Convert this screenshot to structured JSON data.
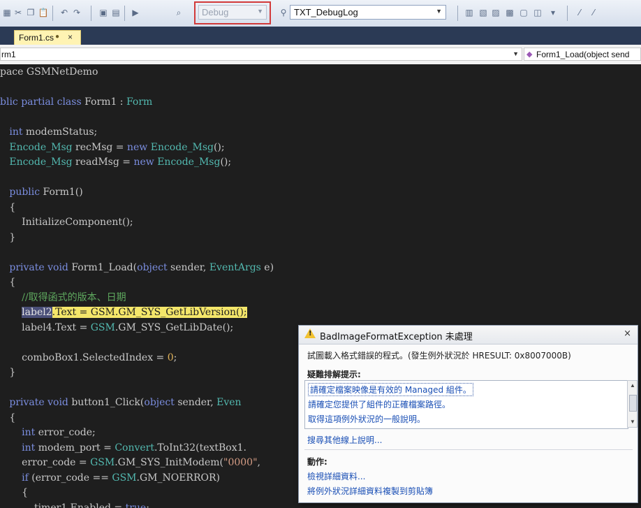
{
  "toolbar": {
    "config_value": "Debug",
    "target_value": "TXT_DebugLog",
    "icons": [
      "solution-icon",
      "cut-icon",
      "copy-icon",
      "paste-icon",
      "undo-icon",
      "redo-icon",
      "save-icon",
      "navigate-icon",
      "start-debug-icon",
      "find-in-files-icon",
      "find-icon",
      "properties-icon",
      "object-browser-icon",
      "toolbox-icon",
      "class-view-icon",
      "start-page-icon",
      "window-icon",
      "overflow-icon",
      "comment-icon",
      "uncomment-icon"
    ]
  },
  "tab": {
    "label": "Form1.cs",
    "pin": "●",
    "close": "×"
  },
  "navbar": {
    "class_value": "rm1",
    "member_value": "Form1_Load(object send"
  },
  "code_lines": [
    {
      "segs": [
        [
          "pace GSMNetDemo",
          ""
        ]
      ]
    },
    {
      "segs": [
        [
          "",
          ""
        ]
      ]
    },
    {
      "segs": [
        [
          "blic ",
          "kw"
        ],
        [
          "partial ",
          "kw"
        ],
        [
          "class ",
          "kw"
        ],
        [
          "Form1 : ",
          ""
        ],
        [
          "Form",
          "ty"
        ]
      ]
    },
    {
      "segs": [
        [
          "",
          ""
        ]
      ]
    },
    {
      "segs": [
        [
          "   int ",
          "kw"
        ],
        [
          "modemStatus;",
          ""
        ]
      ]
    },
    {
      "segs": [
        [
          "   Encode_Msg ",
          "ty"
        ],
        [
          "recMsg = ",
          ""
        ],
        [
          "new ",
          "kw"
        ],
        [
          "Encode_Msg",
          "ty"
        ],
        [
          "();",
          ""
        ]
      ]
    },
    {
      "segs": [
        [
          "   Encode_Msg ",
          "ty"
        ],
        [
          "readMsg = ",
          ""
        ],
        [
          "new ",
          "kw"
        ],
        [
          "Encode_Msg",
          "ty"
        ],
        [
          "();",
          ""
        ]
      ]
    },
    {
      "segs": [
        [
          "",
          ""
        ]
      ]
    },
    {
      "segs": [
        [
          "   public ",
          "kw"
        ],
        [
          "Form1()",
          ""
        ]
      ]
    },
    {
      "segs": [
        [
          "   {",
          ""
        ]
      ]
    },
    {
      "segs": [
        [
          "       InitializeComponent();",
          ""
        ]
      ]
    },
    {
      "segs": [
        [
          "   }",
          ""
        ]
      ]
    },
    {
      "segs": [
        [
          "",
          ""
        ]
      ]
    },
    {
      "segs": [
        [
          "   private ",
          "kw"
        ],
        [
          "void ",
          "kw"
        ],
        [
          "Form1_Load(",
          ""
        ],
        [
          "object ",
          "kw"
        ],
        [
          "sender, ",
          ""
        ],
        [
          "EventArgs ",
          "ty"
        ],
        [
          "e)",
          ""
        ]
      ]
    },
    {
      "segs": [
        [
          "   {",
          ""
        ]
      ]
    },
    {
      "segs": [
        [
          "       //取得函式的版本、日期",
          "cm"
        ]
      ]
    },
    {
      "segs": [
        [
          "       ",
          ""
        ],
        [
          "label2",
          "hl-label"
        ],
        [
          ".Text = ",
          "hl-stmt"
        ],
        [
          "GSM",
          "hl-stmt"
        ],
        [
          ".GM_SYS_GetLibVersion();",
          "hl-stmt"
        ]
      ]
    },
    {
      "segs": [
        [
          "       label4.Text = ",
          ""
        ],
        [
          "GSM",
          "ty"
        ],
        [
          ".GM_SYS_GetLibDate();",
          ""
        ]
      ]
    },
    {
      "segs": [
        [
          "",
          ""
        ]
      ]
    },
    {
      "segs": [
        [
          "       comboBox1.SelectedIndex = ",
          ""
        ],
        [
          "0",
          "nm"
        ],
        [
          ";",
          ""
        ]
      ]
    },
    {
      "segs": [
        [
          "   }",
          ""
        ]
      ]
    },
    {
      "segs": [
        [
          "",
          ""
        ]
      ]
    },
    {
      "segs": [
        [
          "   private ",
          "kw"
        ],
        [
          "void ",
          "kw"
        ],
        [
          "button1_Click(",
          ""
        ],
        [
          "object ",
          "kw"
        ],
        [
          "sender, ",
          ""
        ],
        [
          "Even",
          "ty"
        ]
      ]
    },
    {
      "segs": [
        [
          "   {",
          ""
        ]
      ]
    },
    {
      "segs": [
        [
          "       int ",
          "kw"
        ],
        [
          "error_code;",
          ""
        ]
      ]
    },
    {
      "segs": [
        [
          "       int ",
          "kw"
        ],
        [
          "modem_port = ",
          ""
        ],
        [
          "Convert",
          "ty"
        ],
        [
          ".ToInt32(textBox1.",
          ""
        ]
      ]
    },
    {
      "segs": [
        [
          "       error_code = ",
          ""
        ],
        [
          "GSM",
          "ty"
        ],
        [
          ".GM_SYS_InitModem(",
          ""
        ],
        [
          "\"0000\"",
          "st"
        ],
        [
          ", ",
          ""
        ]
      ]
    },
    {
      "segs": [
        [
          "       if ",
          "kw"
        ],
        [
          "(error_code == ",
          ""
        ],
        [
          "GSM",
          "ty"
        ],
        [
          ".GM_NOERROR)",
          ""
        ]
      ]
    },
    {
      "segs": [
        [
          "       {",
          ""
        ]
      ]
    },
    {
      "segs": [
        [
          "           timer1.Enabled = ",
          ""
        ],
        [
          "true",
          "kw"
        ],
        [
          ";",
          ""
        ]
      ]
    }
  ],
  "popup": {
    "title": "BadImageFormatException 未處理",
    "close": "×",
    "message": "試圖載入格式錯誤的程式。(發生例外狀況於 HRESULT: 0x8007000B)",
    "tips_heading": "疑難排解提示:",
    "tips": [
      "請確定檔案映像是有效的 Managed 組件。",
      "請確定您提供了組件的正確檔案路徑。",
      "取得這項例外狀況的一般說明。"
    ],
    "search_online": "搜尋其他線上說明...",
    "actions_heading": "動作:",
    "actions": [
      "檢視詳細資料...",
      "將例外狀況詳細資料複製到剪貼簿"
    ]
  }
}
